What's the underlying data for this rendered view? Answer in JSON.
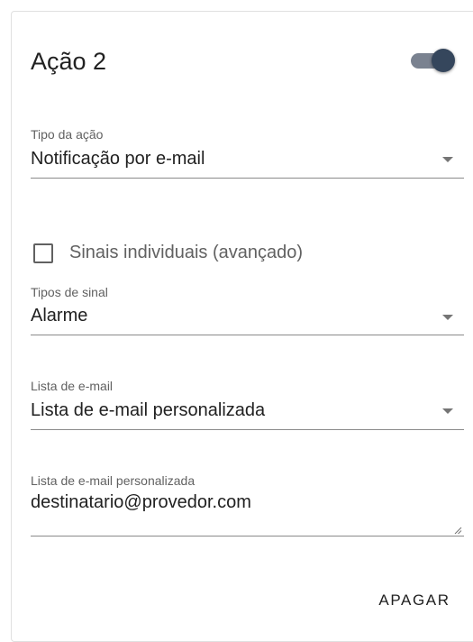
{
  "action": {
    "title": "Ação 2",
    "enabled": true
  },
  "fields": {
    "action_type": {
      "label": "Tipo da ação",
      "value": "Notificação por e-mail"
    },
    "individual_signals": {
      "label": "Sinais individuais (avançado)",
      "checked": false
    },
    "signal_types": {
      "label": "Tipos de sinal",
      "value": "Alarme"
    },
    "email_list": {
      "label": "Lista de e-mail",
      "value": "Lista de e-mail personalizada"
    },
    "custom_email_list": {
      "label": "Lista de e-mail personalizada",
      "value": "destinatario@provedor.com"
    }
  },
  "buttons": {
    "delete_label": "APAGAR"
  },
  "colors": {
    "toggle_thumb": "#35465c",
    "toggle_track": "#7a8290"
  }
}
